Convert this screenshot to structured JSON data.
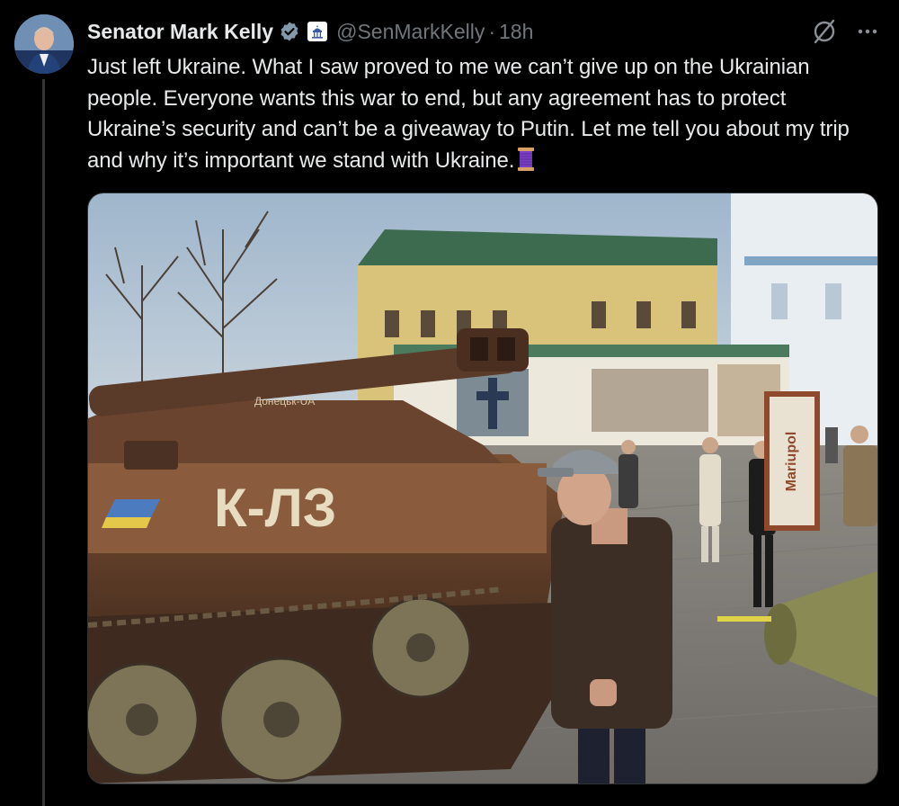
{
  "author": {
    "display_name": "Senator Mark Kelly",
    "handle": "@SenMarkKelly",
    "separator": "·",
    "time": "18h"
  },
  "tweet": {
    "text": "Just left Ukraine. What I saw proved to me we can’t give up on the Ukrainian people. Everyone wants this war to end, but any agreement has to protect Ukraine’s security and can’t be a giveaway to Putin. Let me tell you about my trip and why it’s important we stand with Ukraine."
  },
  "media": {
    "sign_text": "Mariupol",
    "tank_graffiti": "К-ЛЗ",
    "tank_label": "Донецьк-UA"
  },
  "icons": {
    "verified": "verified-badge-icon",
    "government": "capitol-building-icon",
    "grok": "grok-icon",
    "more": "more-options-icon",
    "thread": "spool-of-thread-emoji"
  },
  "colors": {
    "background": "#000000",
    "text": "#e7e9ea",
    "muted": "#71767b",
    "verified": "#829aab"
  }
}
